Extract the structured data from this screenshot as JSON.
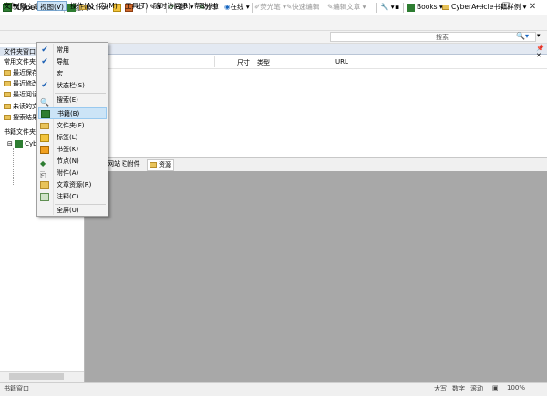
{
  "window": {
    "title": "CyberArticle评估版本"
  },
  "toolbar": {
    "new_article": "新建文章",
    "folder": "文件夹",
    "sync": "同步",
    "share": "分享",
    "online": "在线",
    "highlighter": "荧光笔",
    "quick_edit": "快速编辑",
    "edit_article": "编辑文章",
    "books": "Books",
    "library_sample": "CyberArticle书籍样例"
  },
  "menubar": {
    "items": [
      "文件(F)",
      "视图(V)",
      "操作(A)",
      "宏(M)",
      "工具(T)",
      "随时访问(R)",
      "帮助(H)"
    ],
    "search_label": "搜索"
  },
  "left_panel": {
    "folder_window": "文件夹窗口",
    "common_folders": "常用文件夹",
    "items": [
      "最近保存",
      "最近修改",
      "最近阅读",
      "未读的文章",
      "搜索结果"
    ],
    "book_folders": "书籍文件夹",
    "tree_root": "Cyb"
  },
  "main": {
    "columns": [
      "尺寸",
      "类型",
      "URL"
    ],
    "tabs": [
      "网站",
      "附件",
      "资源"
    ]
  },
  "dropdown": {
    "items": [
      {
        "label": "常用",
        "checked": true
      },
      {
        "label": "导航",
        "checked": true
      },
      {
        "label": "宏",
        "checked": false
      },
      {
        "label": "状态栏(S)",
        "checked": true
      },
      {
        "label": "搜索(E)",
        "icon": "search-icon"
      },
      {
        "label": "书籍(B)",
        "icon": "books-icon",
        "highlighted": true
      },
      {
        "label": "文件夹(F)",
        "icon": "folder-icon"
      },
      {
        "label": "标签(L)",
        "icon": "tag-icon"
      },
      {
        "label": "书签(K)",
        "icon": "bookmark-icon"
      },
      {
        "label": "节点(N)",
        "icon": "node-icon"
      },
      {
        "label": "附件(A)",
        "icon": "attachment-icon"
      },
      {
        "label": "文章资源(R)",
        "icon": "resource-icon"
      },
      {
        "label": "注释(C)",
        "icon": "note-icon"
      },
      {
        "label": "全屏(U)",
        "icon": ""
      }
    ]
  },
  "status": {
    "left": "书籍窗口",
    "caps": "大写",
    "num": "数字",
    "scroll": "滚动",
    "zoom": "100%"
  }
}
